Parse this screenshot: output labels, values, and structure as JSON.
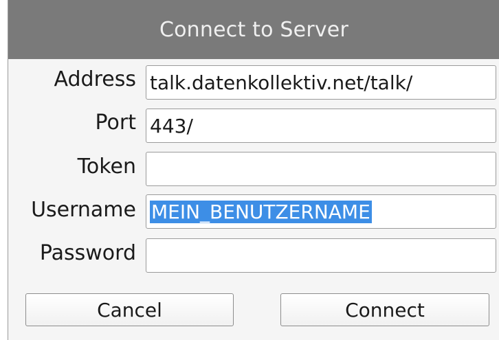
{
  "dialog": {
    "title": "Connect to Server"
  },
  "form": {
    "address": {
      "label": "Address",
      "value": "talk.datenkollektiv.net/talk/"
    },
    "port": {
      "label": "Port",
      "value": "443/"
    },
    "token": {
      "label": "Token",
      "value": ""
    },
    "username": {
      "label": "Username",
      "value": "MEIN_BENUTZERNAME"
    },
    "password": {
      "label": "Password",
      "value": ""
    }
  },
  "buttons": {
    "cancel": "Cancel",
    "connect": "Connect"
  }
}
